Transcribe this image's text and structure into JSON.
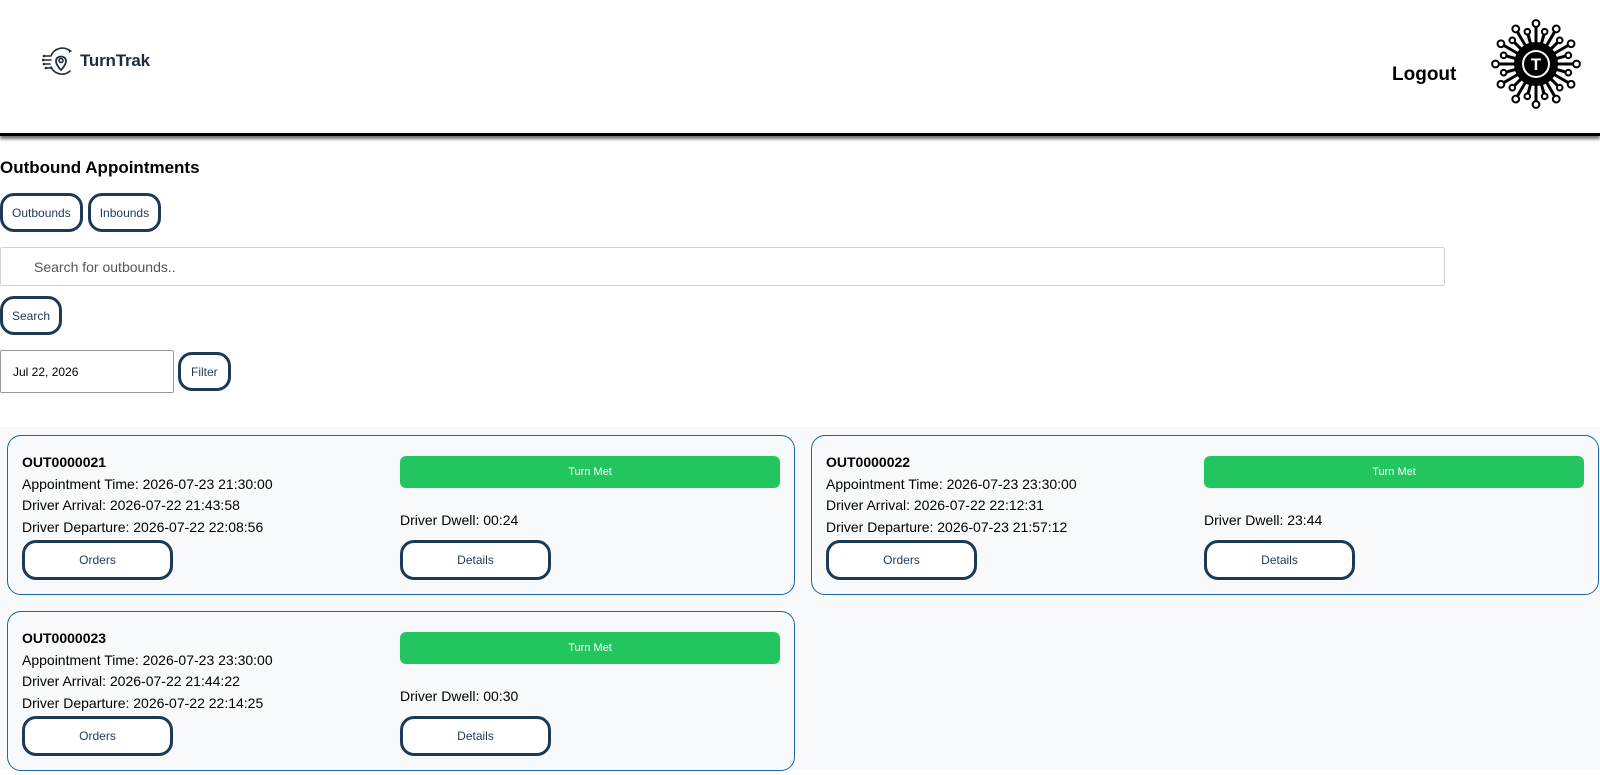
{
  "header": {
    "brand": "TurnTrak",
    "logout": "Logout",
    "avatar_letter": "T"
  },
  "page_title": "Outbound Appointments",
  "tabs": [
    {
      "label": "Outbounds"
    },
    {
      "label": "Inbounds"
    }
  ],
  "search": {
    "placeholder": "Search for outbounds..",
    "button": "Search"
  },
  "date_filter": {
    "value": "Jul 22, 2026",
    "button": "Filter"
  },
  "cards": [
    {
      "id": "OUT0000021",
      "appointment": "Appointment Time: 2026-07-23 21:30:00",
      "arrival": "Driver Arrival: 2026-07-22 21:43:58",
      "departure": "Driver Departure: 2026-07-22 22:08:56",
      "status": "Turn Met",
      "dwell": "Driver Dwell: 00:24",
      "orders": "Orders",
      "details": "Details"
    },
    {
      "id": "OUT0000022",
      "appointment": "Appointment Time: 2026-07-23 23:30:00",
      "arrival": "Driver Arrival: 2026-07-22 22:12:31",
      "departure": "Driver Departure: 2026-07-23 21:57:12",
      "status": "Turn Met",
      "dwell": "Driver Dwell: 23:44",
      "orders": "Orders",
      "details": "Details"
    },
    {
      "id": "OUT0000023",
      "appointment": "Appointment Time: 2026-07-23 23:30:00",
      "arrival": "Driver Arrival: 2026-07-22 21:44:22",
      "departure": "Driver Departure: 2026-07-22 22:14:25",
      "status": "Turn Met",
      "dwell": "Driver Dwell: 00:30",
      "orders": "Orders",
      "details": "Details"
    }
  ],
  "colors": {
    "accent": "#1b3a57",
    "card_border": "#1b66a3",
    "status_green": "#22c55e"
  }
}
